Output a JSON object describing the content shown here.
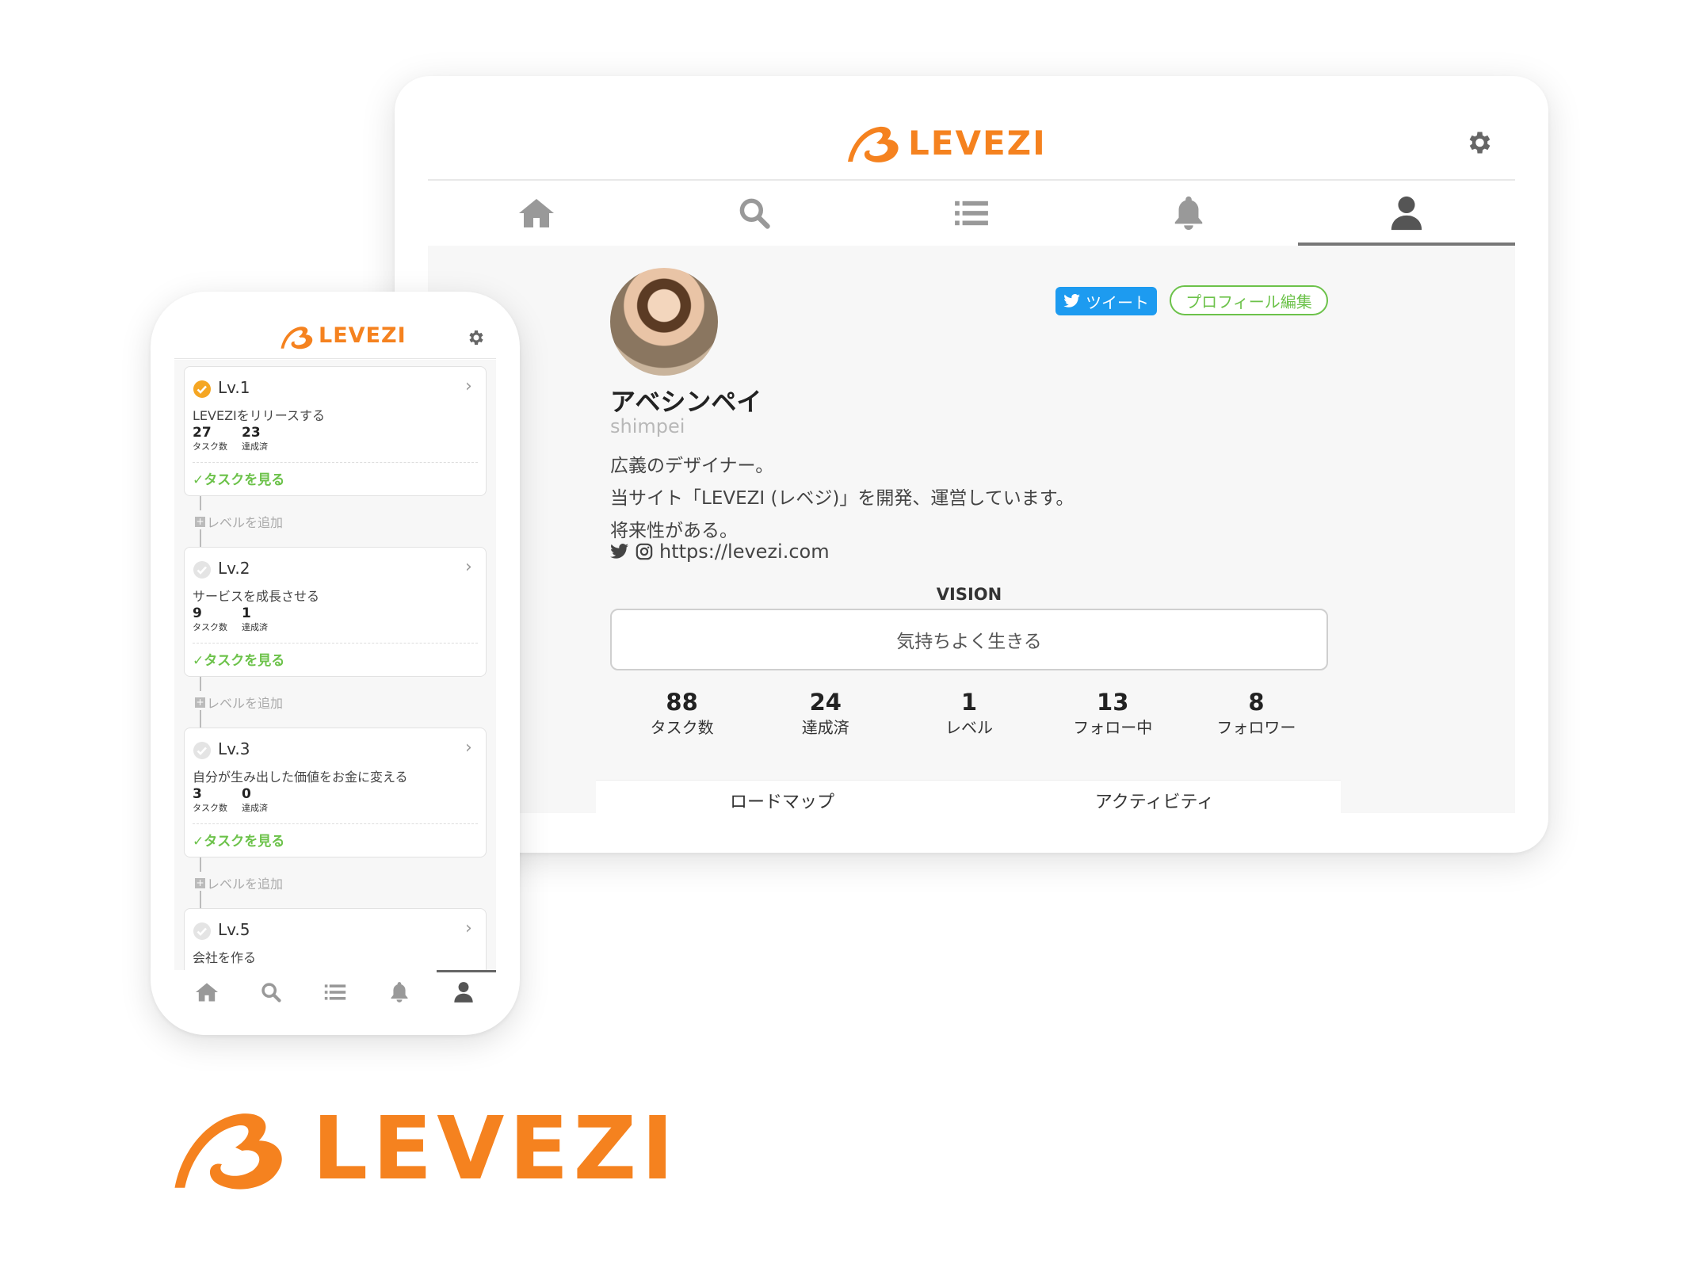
{
  "brand": {
    "name": "LEVEZI",
    "accent": "#f5821f",
    "green": "#6cc24a",
    "twitter_blue": "#1d9bf0"
  },
  "tablet": {
    "nav": [
      "home-icon",
      "search-icon",
      "list-icon",
      "bell-icon",
      "user-icon"
    ],
    "active_nav": "user-icon",
    "profile": {
      "tweet_label": "ツイート",
      "edit_label": "プロフィール編集",
      "name": "アベシンペイ",
      "handle": "shimpei",
      "bio": [
        "広義のデザイナー。",
        "当サイト「LEVEZI (レベジ)」を開発、運営しています。",
        "将来性がある。"
      ],
      "url": "https://levezi.com",
      "vision_label": "VISION",
      "vision": "気持ちよく生きる",
      "stats": [
        {
          "value": "88",
          "label": "タスク数"
        },
        {
          "value": "24",
          "label": "達成済"
        },
        {
          "value": "1",
          "label": "レベル"
        },
        {
          "value": "13",
          "label": "フォロー中"
        },
        {
          "value": "8",
          "label": "フォロワー"
        }
      ],
      "tabs": [
        "ロードマップ",
        "アクティビティ"
      ]
    }
  },
  "phone": {
    "levels": [
      {
        "title": "Lv.1",
        "desc": "LEVEZIをリリースする",
        "tasks": "27",
        "tasks_label": "タスク数",
        "done": "23",
        "done_label": "達成済",
        "link": "タスクを見る",
        "completed": true
      },
      {
        "title": "Lv.2",
        "desc": "サービスを成長させる",
        "tasks": "9",
        "tasks_label": "タスク数",
        "done": "1",
        "done_label": "達成済",
        "link": "タスクを見る",
        "completed": false
      },
      {
        "title": "Lv.3",
        "desc": "自分が生み出した価値をお金に変える",
        "tasks": "3",
        "tasks_label": "タスク数",
        "done": "0",
        "done_label": "達成済",
        "link": "タスクを見る",
        "completed": false
      },
      {
        "title": "Lv.5",
        "desc": "会社を作る",
        "completed": false
      }
    ],
    "add_level_label": "レベルを追加",
    "nav": [
      "home-icon",
      "search-icon",
      "list-icon",
      "bell-icon",
      "user-icon"
    ],
    "active_nav": "user-icon"
  }
}
